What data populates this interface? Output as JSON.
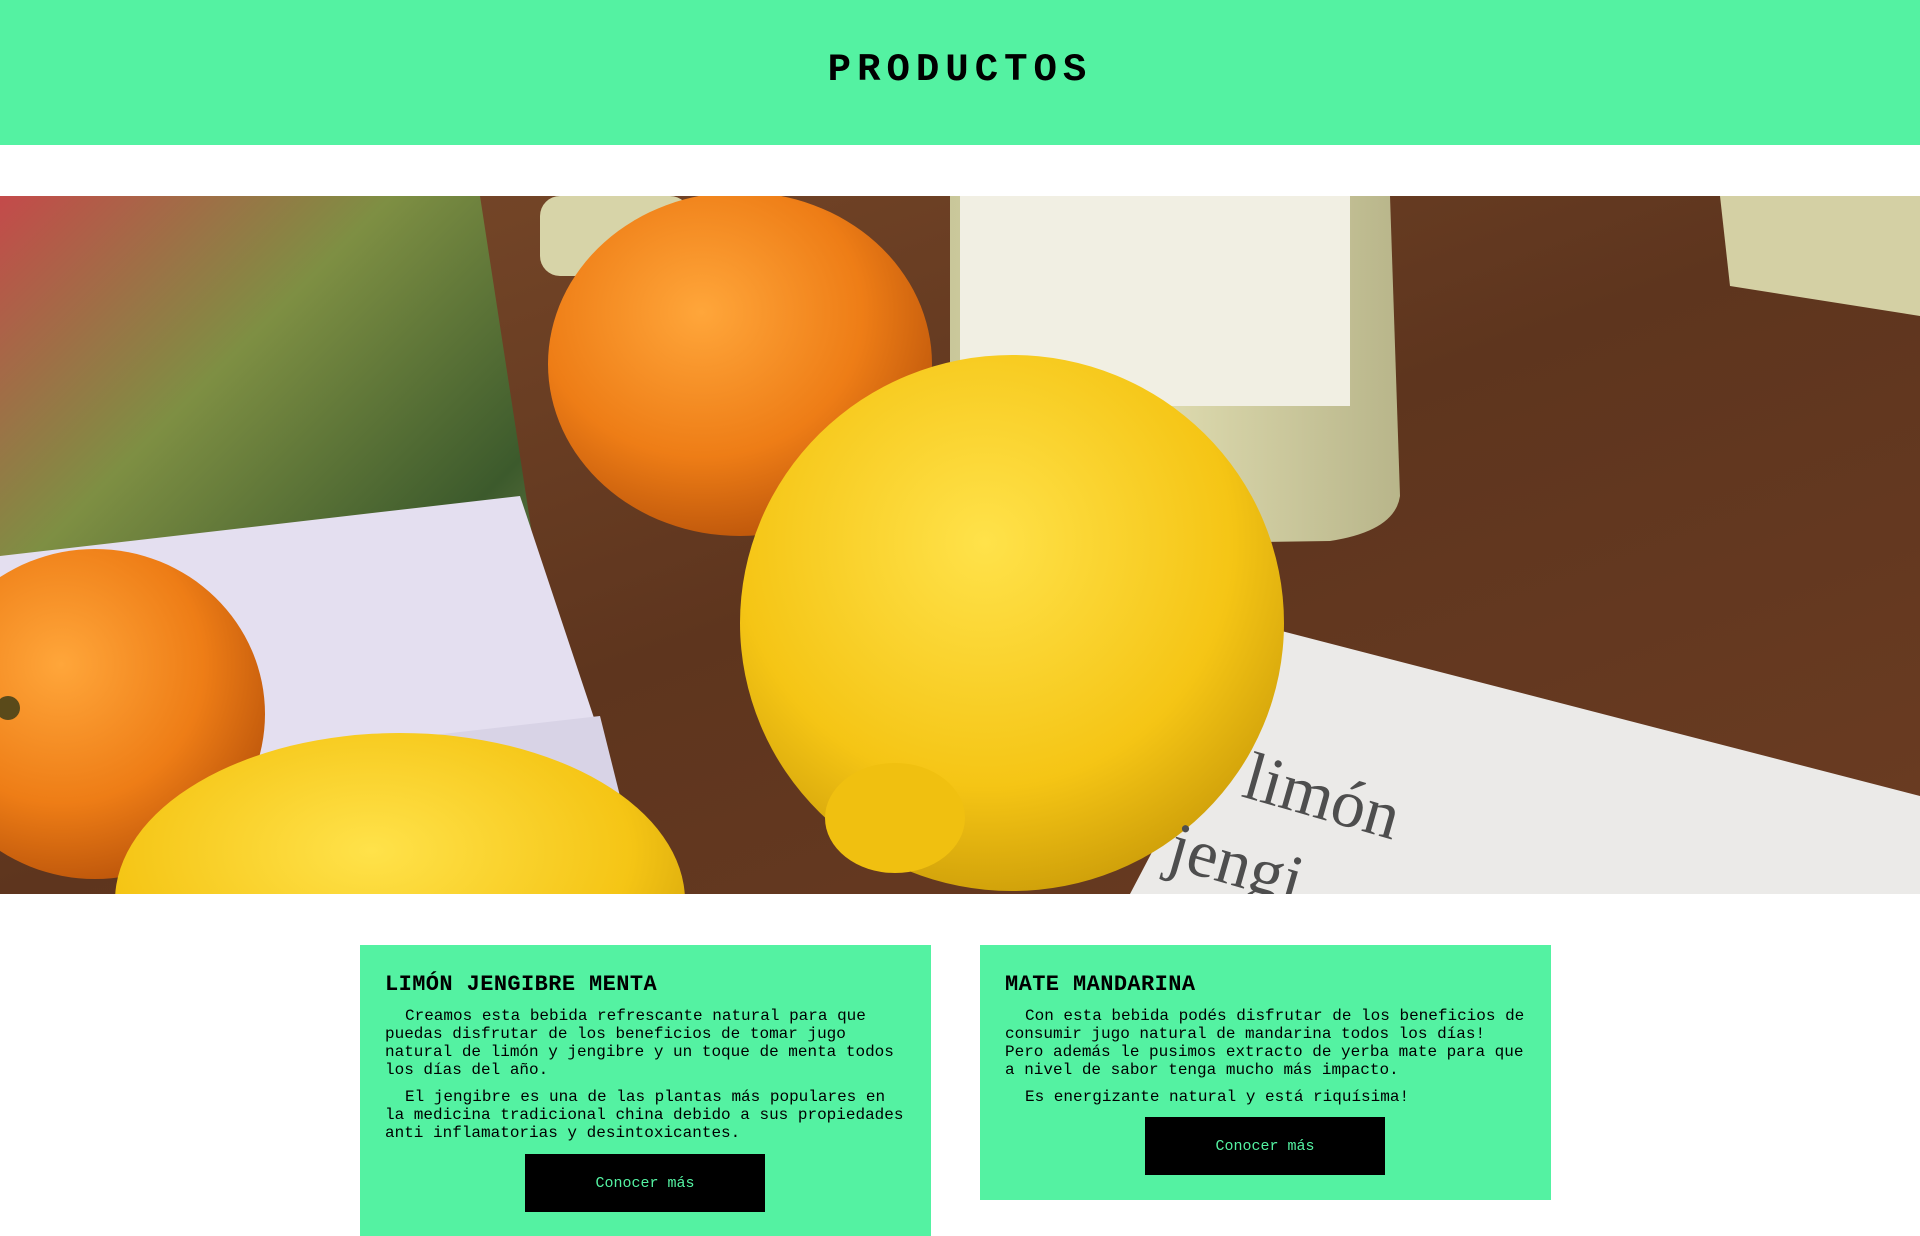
{
  "header": {
    "title": "PRODUCTOS"
  },
  "hero": {
    "overlay_text": [
      "limón",
      "jengi"
    ]
  },
  "products": [
    {
      "title": "LIMÓN JENGIBRE MENTA",
      "paragraphs": [
        "Creamos esta bebida refrescante natural para que puedas disfrutar de los beneficios de tomar jugo natural de limón y jengibre y un toque de menta todos los días del año.",
        "El jengibre es una de las plantas más populares en la medicina tradicional china debido a sus propiedades anti inflamatorias y desintoxicantes."
      ],
      "button_label": "Conocer más"
    },
    {
      "title": "MATE MANDARINA",
      "paragraphs": [
        "Con esta bebida podés disfrutar de los beneficios de consumir jugo natural de mandarina todos los días! Pero además le pusimos extracto de yerba mate para que a nivel de sabor tenga mucho más impacto.",
        "Es energizante natural y está riquísima!"
      ],
      "button_label": "Conocer más"
    }
  ],
  "colors": {
    "accent": "#54f2a2",
    "button_bg": "#000000"
  }
}
